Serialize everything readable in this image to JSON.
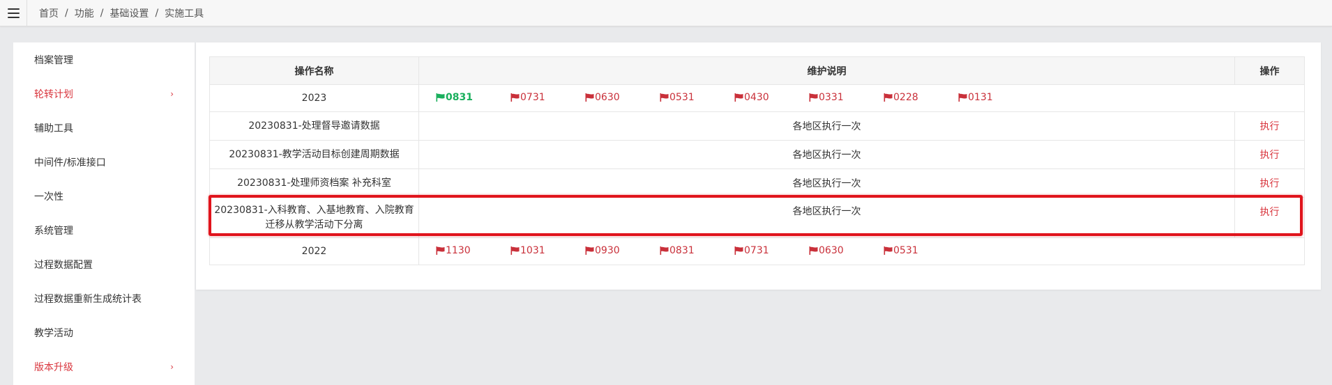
{
  "breadcrumb": [
    "首页",
    "功能",
    "基础设置",
    "实施工具"
  ],
  "sidebar": {
    "items": [
      {
        "label": "档案管理",
        "red": false,
        "chevron": false
      },
      {
        "label": "轮转计划",
        "red": true,
        "chevron": true
      },
      {
        "label": "辅助工具",
        "red": false,
        "chevron": false
      },
      {
        "label": "中间件/标准接口",
        "red": false,
        "chevron": false
      },
      {
        "label": "一次性",
        "red": false,
        "chevron": false
      },
      {
        "label": "系统管理",
        "red": false,
        "chevron": false
      },
      {
        "label": "过程数据配置",
        "red": false,
        "chevron": false
      },
      {
        "label": "过程数据重新生成统计表",
        "red": false,
        "chevron": false
      },
      {
        "label": "教学活动",
        "red": false,
        "chevron": false
      },
      {
        "label": "版本升级",
        "red": true,
        "chevron": true
      }
    ],
    "chevron_glyph": "›"
  },
  "table": {
    "headers": {
      "name": "操作名称",
      "desc": "维护说明",
      "action": "操作"
    },
    "year_2023": {
      "label": "2023",
      "flags": [
        "0831",
        "0731",
        "0630",
        "0531",
        "0430",
        "0331",
        "0228",
        "0131"
      ],
      "active_flag": "0831"
    },
    "rows": [
      {
        "name": "20230831-处理督导邀请数据",
        "desc": "各地区执行一次",
        "action": "执行"
      },
      {
        "name": "20230831-教学活动目标创建周期数据",
        "desc": "各地区执行一次",
        "action": "执行"
      },
      {
        "name": "20230831-处理师资档案 补充科室",
        "desc": "各地区执行一次",
        "action": "执行"
      },
      {
        "name_line1": "20230831-入科教育、入基地教育、入院教育",
        "name_line2": "迁移从教学活动下分离",
        "desc": "各地区执行一次",
        "action": "执行"
      }
    ],
    "year_2022": {
      "label": "2022",
      "flags": [
        "1130",
        "1031",
        "0930",
        "0831",
        "0731",
        "0630",
        "0531"
      ]
    }
  },
  "colors": {
    "accent_red": "#d9363e",
    "flag_red": "#c9303a",
    "flag_active_green": "#1aaf5d",
    "highlight_box": "#e0141c"
  }
}
